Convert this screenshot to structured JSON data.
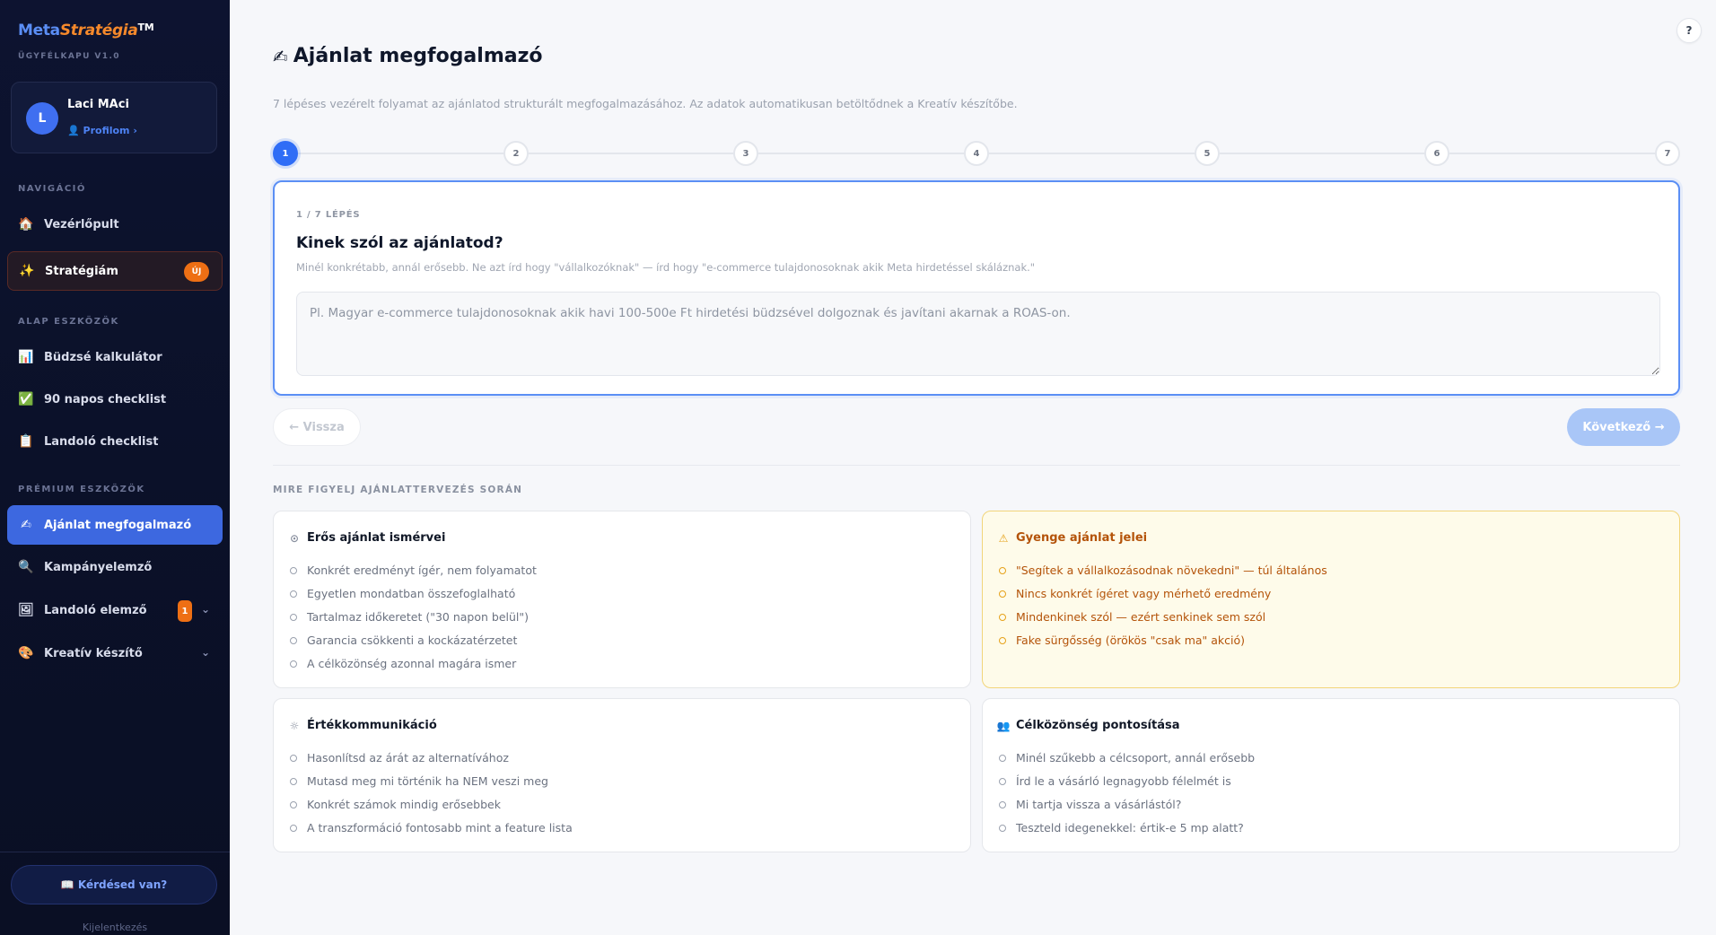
{
  "brand": {
    "meta": "Meta",
    "strat": "Stratégia",
    "tm": "TM",
    "subtitle": "ÜGYFÉLKAPU V1.0"
  },
  "user": {
    "initial": "L",
    "name": "Laci MAci",
    "profile_link": "👤 Profilom ›"
  },
  "sidebar": {
    "nav_label": "NAVIGÁCIÓ",
    "alap_label": "ALAP ESZKÖZÖK",
    "premium_label": "PRÉMIUM ESZKÖZÖK",
    "items": [
      {
        "label": "Vezérlőpult",
        "icon": "🏠"
      },
      {
        "label": "Stratégiám",
        "icon": "✨",
        "badge": "ÚJ"
      },
      {
        "label": "Büdzsé kalkulátor",
        "icon": "📊"
      },
      {
        "label": "90 napos checklist",
        "icon": "✅"
      },
      {
        "label": "Landoló checklist",
        "icon": "📋"
      },
      {
        "label": "Ajánlat megfogalmazó",
        "icon": "✍"
      },
      {
        "label": "Kampányelemző",
        "icon": "🔍"
      },
      {
        "label": "Landoló elemző",
        "icon": "🖼",
        "badge": "1"
      },
      {
        "label": "Kreatív készítő",
        "icon": "🎨"
      }
    ],
    "help_button": "📖 Kérdésed van?",
    "logout": "Kijelentkezés"
  },
  "header": {
    "help": "?",
    "title_icon": "✍",
    "title": "Ajánlat megfogalmazó",
    "subtitle": "7 lépéses vezérelt folyamat az ajánlatod strukturált megfogalmazásához. Az adatok automatikusan betöltődnek a Kreatív készítőbe."
  },
  "stepper": {
    "steps": [
      "1",
      "2",
      "3",
      "4",
      "5",
      "6",
      "7"
    ],
    "active": 1
  },
  "step_card": {
    "kicker": "1 / 7 LÉPÉS",
    "question": "Kinek szól az ajánlatod?",
    "hint": "Minél konkrétabb, annál erősebb. Ne azt írd hogy \"vállalkozóknak\" — írd hogy \"e-commerce tulajdonosoknak akik Meta hirdetéssel skáláznak.\"",
    "placeholder": "Pl. Magyar e-commerce tulajdonosoknak akik havi 100-500e Ft hirdetési büdzsével dolgoznak és javítani akarnak a ROAS-on."
  },
  "nav_buttons": {
    "back": "← Vissza",
    "next": "Következő →"
  },
  "tips": {
    "title": "MIRE FIGYELJ AJÁNLATTERVEZÉS SORÁN",
    "strong": {
      "icon": "⊙",
      "title": "Erős ajánlat ismérvei",
      "items": [
        "Konkrét eredményt ígér, nem folyamatot",
        "Egyetlen mondatban összefoglalható",
        "Tartalmaz időkeretet (\"30 napon belül\")",
        "Garancia csökkenti a kockázatérzetet",
        "A célközönség azonnal magára ismer"
      ]
    },
    "weak": {
      "icon": "⚠",
      "title": "Gyenge ajánlat jelei",
      "items": [
        "\"Segítek a vállalkozásodnak növekedni\" — túl általános",
        "Nincs konkrét ígéret vagy mérhető eredmény",
        "Mindenkinek szól — ezért senkinek sem szól",
        "Fake sürgősség (örökös \"csak ma\" akció)"
      ]
    },
    "value": {
      "icon": "☼",
      "title": "Értékkommunikáció",
      "items": [
        "Hasonlítsd az árát az alternatívához",
        "Mutasd meg mi történik ha NEM veszi meg",
        "Konkrét számok mindig erősebbek",
        "A transzformáció fontosabb mint a feature lista"
      ]
    },
    "audience": {
      "icon": "👥",
      "title": "Célközönség pontosítása",
      "items": [
        "Minél szűkebb a célcsoport, annál erősebb",
        "Írd le a vásárló legnagyobb félelmét is",
        "Mi tartja vissza a vásárlástól?",
        "Teszteld idegenekkel: értik-e 5 mp alatt?"
      ]
    }
  }
}
